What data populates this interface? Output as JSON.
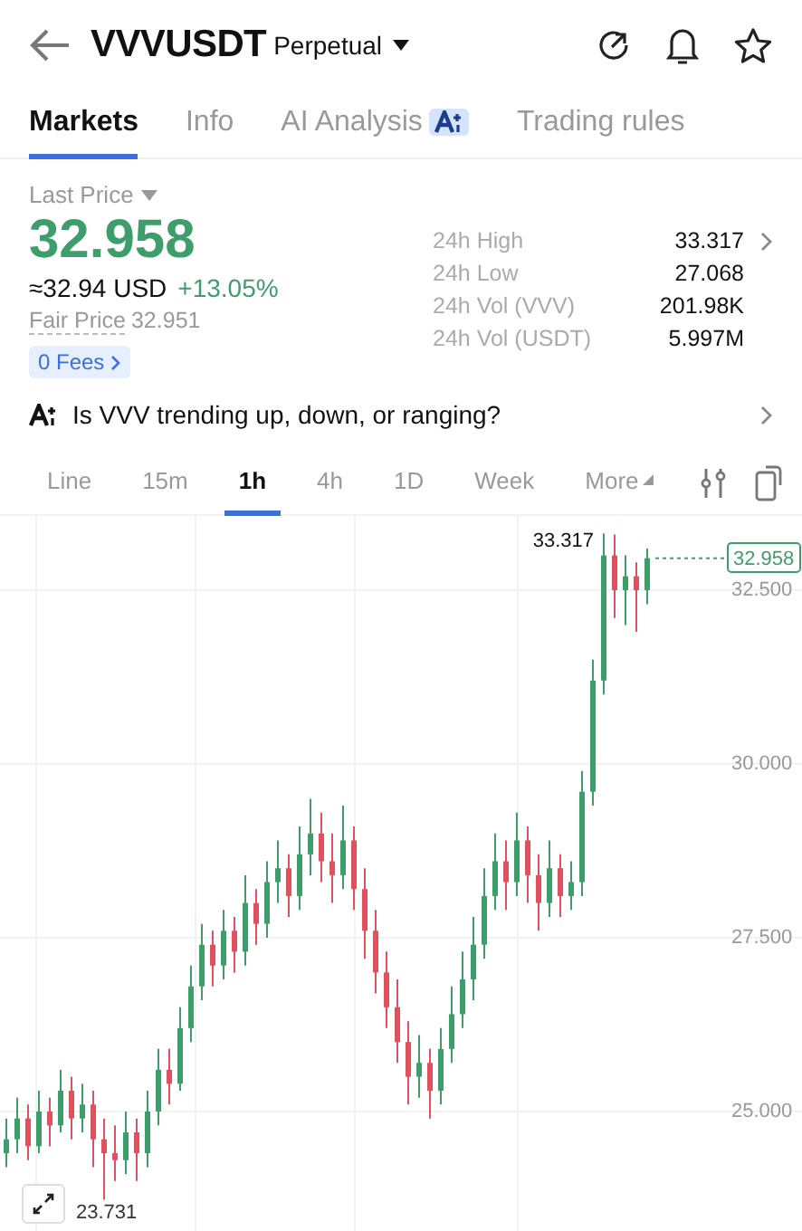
{
  "header": {
    "symbol": "VVVUSDT",
    "contract": "Perpetual"
  },
  "tabs": [
    {
      "label": "Markets",
      "selected": true
    },
    {
      "label": "Info",
      "selected": false
    },
    {
      "label": "AI Analysis",
      "selected": false,
      "ai_badge": true
    },
    {
      "label": "Trading rules",
      "selected": false
    }
  ],
  "price": {
    "label": "Last Price",
    "value": "32.958",
    "usd": "≈32.94 USD",
    "change": "+13.05%",
    "fair_label": "Fair Price",
    "fair_value": "32.951",
    "fees": "0 Fees"
  },
  "stats": [
    {
      "label": "24h High",
      "value": "33.317",
      "link": true
    },
    {
      "label": "24h Low",
      "value": "27.068",
      "link": false
    },
    {
      "label": "24h Vol (VVV)",
      "value": "201.98K",
      "link": false
    },
    {
      "label": "24h Vol (USDT)",
      "value": "5.997M",
      "link": false
    }
  ],
  "question": "Is VVV trending up, down, or ranging?",
  "intervals": [
    {
      "label": "Line",
      "selected": false
    },
    {
      "label": "15m",
      "selected": false
    },
    {
      "label": "1h",
      "selected": true
    },
    {
      "label": "4h",
      "selected": false
    },
    {
      "label": "1D",
      "selected": false
    },
    {
      "label": "Week",
      "selected": false
    },
    {
      "label": "More",
      "selected": false
    }
  ],
  "chart": {
    "high_label": "33.317",
    "low_label": "23.731",
    "current": "32.958",
    "chart_data": {
      "type": "candlestick",
      "grid": true,
      "ylim": [
        23.281,
        33.568
      ],
      "yticks": [
        {
          "value": 32.5,
          "label": "32.500"
        },
        {
          "value": 30,
          "label": "30.000"
        },
        {
          "value": 27.5,
          "label": "27.500"
        },
        {
          "value": 25,
          "label": "25.000"
        }
      ],
      "categories": [
        null,
        null,
        null,
        null,
        null,
        null,
        null,
        null,
        null,
        null,
        null,
        null,
        null,
        null,
        null,
        null,
        null,
        null,
        null,
        null,
        null,
        null,
        null,
        null,
        null,
        null,
        null,
        null,
        null,
        null,
        null,
        null,
        null,
        null,
        null,
        null,
        null,
        null,
        null,
        null,
        null,
        null,
        null,
        null,
        null,
        null,
        null,
        null,
        null,
        null,
        null,
        null,
        null,
        null,
        null,
        null,
        null,
        null,
        null,
        null
      ],
      "ohlc": [
        [
          24.4,
          24.9,
          24.2,
          24.6
        ],
        [
          24.6,
          25.2,
          24.4,
          24.9
        ],
        [
          24.9,
          25.1,
          24.3,
          24.5
        ],
        [
          24.5,
          25.3,
          24.4,
          25.0
        ],
        [
          25.0,
          25.2,
          24.5,
          24.8
        ],
        [
          24.8,
          25.6,
          24.7,
          25.3
        ],
        [
          25.3,
          25.5,
          24.6,
          24.9
        ],
        [
          24.9,
          25.4,
          24.7,
          25.1
        ],
        [
          25.1,
          25.3,
          24.2,
          24.6
        ],
        [
          24.6,
          24.9,
          23.73,
          24.4
        ],
        [
          24.4,
          24.8,
          24.0,
          24.3
        ],
        [
          24.3,
          25.0,
          24.1,
          24.7
        ],
        [
          24.7,
          24.9,
          24.0,
          24.4
        ],
        [
          24.4,
          25.3,
          24.2,
          25.0
        ],
        [
          25.0,
          25.9,
          24.8,
          25.6
        ],
        [
          25.6,
          25.9,
          25.1,
          25.4
        ],
        [
          25.4,
          26.5,
          25.3,
          26.2
        ],
        [
          26.2,
          27.1,
          26.0,
          26.8
        ],
        [
          26.8,
          27.7,
          26.6,
          27.4
        ],
        [
          27.4,
          27.6,
          26.8,
          27.1
        ],
        [
          27.1,
          27.9,
          26.9,
          27.6
        ],
        [
          27.6,
          27.8,
          27.0,
          27.3
        ],
        [
          27.3,
          28.4,
          27.1,
          28.0
        ],
        [
          28.0,
          28.2,
          27.4,
          27.7
        ],
        [
          27.7,
          28.6,
          27.5,
          28.3
        ],
        [
          28.3,
          28.9,
          28.0,
          28.5
        ],
        [
          28.5,
          28.7,
          27.8,
          28.1
        ],
        [
          28.1,
          29.1,
          27.9,
          28.7
        ],
        [
          28.7,
          29.5,
          28.4,
          29.0
        ],
        [
          29.0,
          29.3,
          28.3,
          28.6
        ],
        [
          28.6,
          29.0,
          28.0,
          28.4
        ],
        [
          28.4,
          29.4,
          28.2,
          28.9
        ],
        [
          28.9,
          29.1,
          27.9,
          28.2
        ],
        [
          28.2,
          28.5,
          27.2,
          27.6
        ],
        [
          27.6,
          27.9,
          26.7,
          27.0
        ],
        [
          27.0,
          27.3,
          26.2,
          26.5
        ],
        [
          26.5,
          26.9,
          25.7,
          26.0
        ],
        [
          26.0,
          26.3,
          25.1,
          25.5
        ],
        [
          25.5,
          26.1,
          25.2,
          25.7
        ],
        [
          25.7,
          25.9,
          24.9,
          25.3
        ],
        [
          25.3,
          26.2,
          25.1,
          25.9
        ],
        [
          25.9,
          26.8,
          25.7,
          26.4
        ],
        [
          26.4,
          27.3,
          26.2,
          26.9
        ],
        [
          26.9,
          27.8,
          26.6,
          27.4
        ],
        [
          27.4,
          28.5,
          27.2,
          28.1
        ],
        [
          28.1,
          29.0,
          27.9,
          28.6
        ],
        [
          28.6,
          28.9,
          27.9,
          28.3
        ],
        [
          28.3,
          29.3,
          28.1,
          28.9
        ],
        [
          28.9,
          29.1,
          28.0,
          28.4
        ],
        [
          28.4,
          28.7,
          27.6,
          28.0
        ],
        [
          28.0,
          28.9,
          27.8,
          28.5
        ],
        [
          28.5,
          28.7,
          27.8,
          28.1
        ],
        [
          28.1,
          28.6,
          27.9,
          28.3
        ],
        [
          28.3,
          29.9,
          28.1,
          29.6
        ],
        [
          29.6,
          31.5,
          29.4,
          31.2
        ],
        [
          31.2,
          33.317,
          31.0,
          33.0
        ],
        [
          33.0,
          33.3,
          32.1,
          32.5
        ],
        [
          32.5,
          33.0,
          32.0,
          32.7
        ],
        [
          32.7,
          32.9,
          31.9,
          32.5
        ],
        [
          32.5,
          33.1,
          32.3,
          32.96
        ]
      ]
    }
  }
}
